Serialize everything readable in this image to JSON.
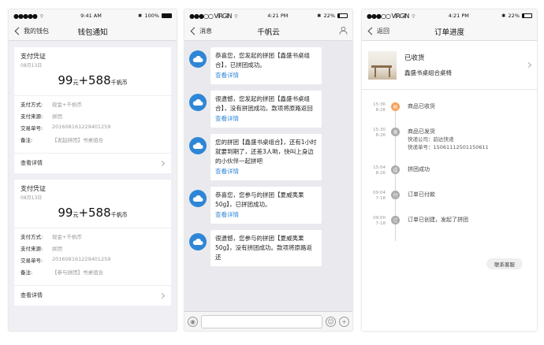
{
  "phone1": {
    "status": {
      "carrier": "●●●●● ",
      "time": "9:41 AM",
      "battery": "100%",
      "battery_level": 1.0
    },
    "nav": {
      "back_label": "我的钱包",
      "title": "钱包通知"
    },
    "cards": [
      {
        "title": "支付凭证",
        "date": "08月13日",
        "amount_cash": "99",
        "unit_cash": "元",
        "plus": "+",
        "amount_coin": "588",
        "unit_coin": "千帆币",
        "rows": [
          {
            "k": "支付方式:",
            "v": "现金+千帆币"
          },
          {
            "k": "支付来源:",
            "v": "拼团"
          },
          {
            "k": "交易单号:",
            "v": "201608161229401259"
          },
          {
            "k": "备注:",
            "v": "【发起拼团】书桌组合"
          }
        ],
        "detail_label": "查看详情"
      },
      {
        "title": "支付凭证",
        "date": "08月13日",
        "amount_cash": "99",
        "unit_cash": "元",
        "plus": "+",
        "amount_coin": "588",
        "unit_coin": "千帆币",
        "rows": [
          {
            "k": "支付方式:",
            "v": "现金+千帆币"
          },
          {
            "k": "支付来源:",
            "v": "拼团"
          },
          {
            "k": "交易单号:",
            "v": "201608161229401259"
          },
          {
            "k": "备注:",
            "v": "【参与拼团】书桌组合"
          }
        ],
        "detail_label": "查看详情"
      }
    ]
  },
  "phone2": {
    "status": {
      "carrier": "●●●○○ VIRGIN",
      "time": "4:21 PM",
      "battery": "22%",
      "battery_level": 0.22
    },
    "nav": {
      "back_label": "消息",
      "title": "千帆云"
    },
    "messages": [
      {
        "text": "恭喜您，您发起的拼团【鑫盛书桌组合】，已拼团成功。",
        "link": "查看详情"
      },
      {
        "text": "很遗憾，您发起的拼团【鑫盛书桌组合】，没有拼团成功。款项将原路返回",
        "link": "查看详情"
      },
      {
        "text": "您的拼团【鑫盛书桌组合】，还有1小时就要到期了，还差3人哟，快叫上身边的小伙伴一起拼吧",
        "link": "查看详情"
      },
      {
        "text": "恭喜您，您参与的拼团【夏威夷果50g】，已拼团成功。",
        "link": "查看详情"
      },
      {
        "text": "很遗憾，您参与的拼团【夏威夷果50g】，没有拼团成功。款项将原路返还",
        "link": ""
      }
    ]
  },
  "phone3": {
    "status": {
      "carrier": "●●●○○ VIRGIN",
      "time": "4:21 PM",
      "battery": "22%",
      "battery_level": 0.22
    },
    "nav": {
      "back_label": "返回",
      "title": "订单进度"
    },
    "order": {
      "status": "已收货",
      "item": "鑫盛书桌组合桌椅"
    },
    "timeline": [
      {
        "time": "15:36",
        "date": "8-26",
        "badge": "收",
        "text": "商品已收货",
        "sub1": "",
        "sub2": "",
        "active": true
      },
      {
        "time": "15:30",
        "date": "8-26",
        "badge": "发",
        "text": "商品已发货",
        "sub1": "快递公司：韵达快递",
        "sub2": "快递单号：15061112501150611",
        "active": false
      },
      {
        "time": "15:04",
        "date": "8-26",
        "badge": "成",
        "text": "拼团成功",
        "sub1": "",
        "sub2": "",
        "active": false
      },
      {
        "time": "09:04",
        "date": "7-18",
        "badge": "付",
        "text": "订单已付款",
        "sub1": "",
        "sub2": "",
        "active": false
      },
      {
        "time": "09:00",
        "date": "7-18",
        "badge": "订",
        "text": "订单已创建，发起了拼团",
        "sub1": "",
        "sub2": "",
        "active": false
      }
    ],
    "service_label": "联系客服"
  }
}
